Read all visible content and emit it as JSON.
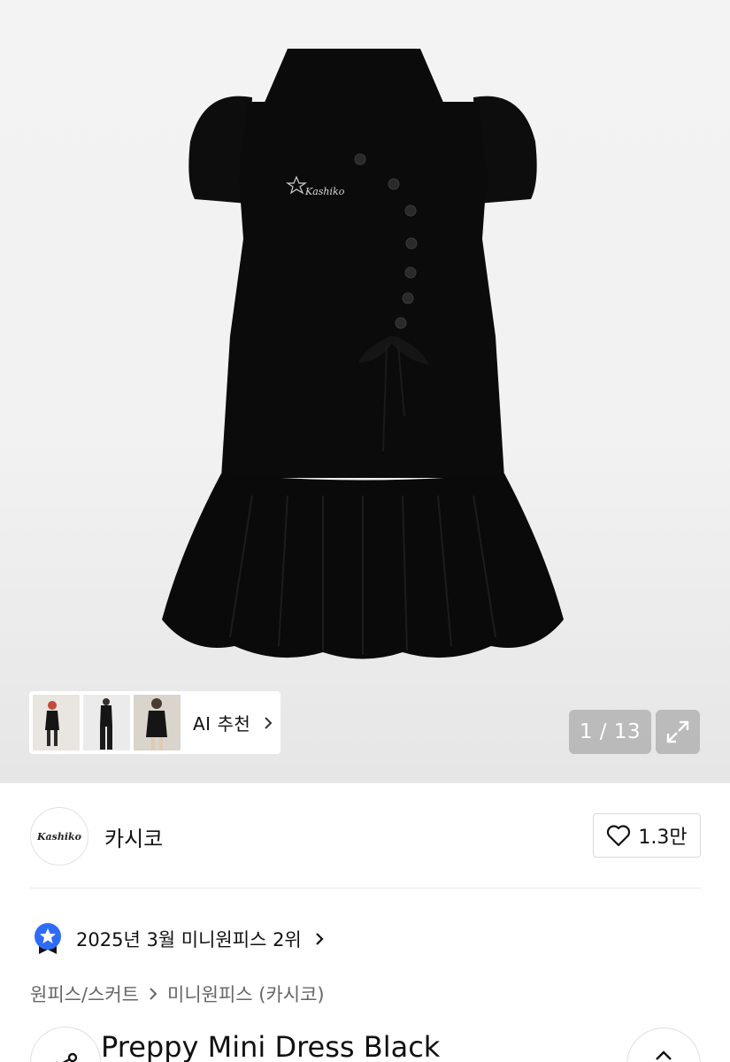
{
  "gallery": {
    "ai_recommend_label": "AI 추천",
    "counter": "1 / 13",
    "thumbnails": [
      "look-1",
      "look-2",
      "look-3"
    ],
    "logo_text": "Kashiko"
  },
  "brand": {
    "name": "카시코",
    "logo_text": "Kashiko",
    "like_count": "1.3만"
  },
  "ranking": {
    "text": "2025년 3월 미니원피스 2위"
  },
  "breadcrumb": {
    "items": [
      "원피스/스커트",
      "미니원피스 (카시코)"
    ]
  },
  "product": {
    "title": "Preppy Mini Dress Black"
  },
  "colors": {
    "accent_blue": "#2f6cf6",
    "dress": "#0b0b0b"
  },
  "icons": [
    "heart-icon",
    "chevron-right-icon",
    "expand-icon",
    "ranking-badge-icon",
    "share-icon",
    "arrow-up-icon"
  ]
}
